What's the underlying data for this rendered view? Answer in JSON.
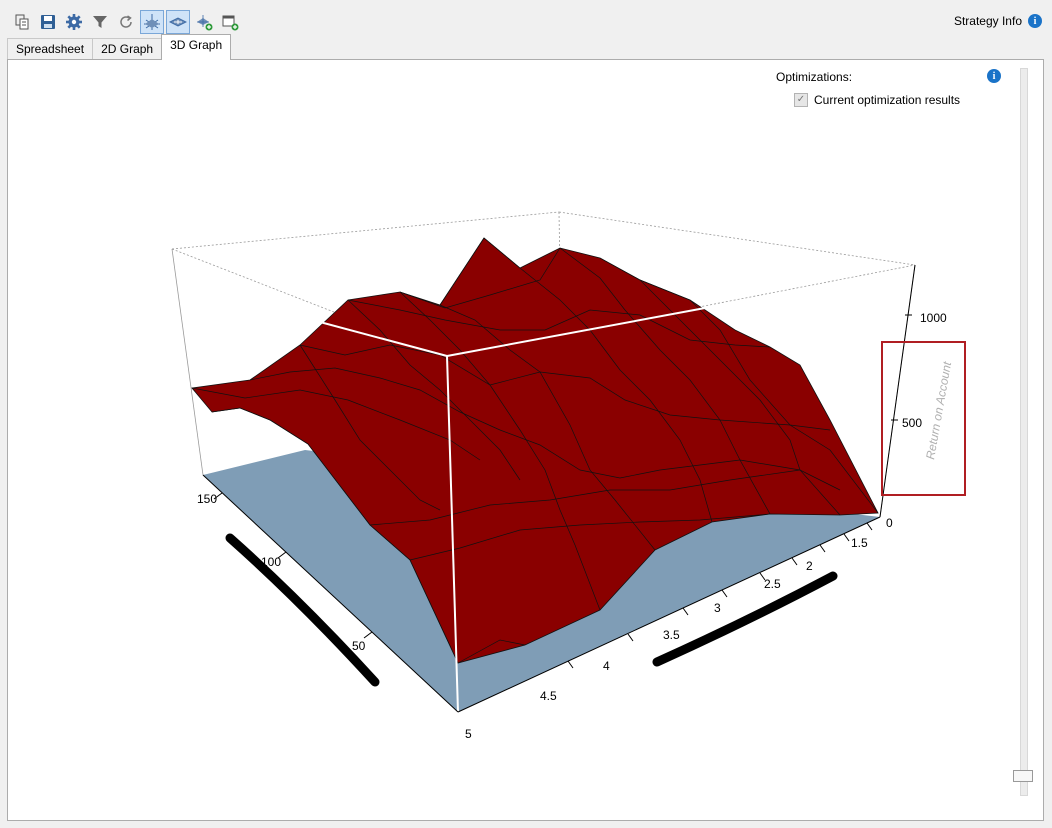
{
  "toolbar": {
    "buttons": [
      {
        "icon": "copy-icon",
        "active": false
      },
      {
        "icon": "save-icon",
        "active": false
      },
      {
        "icon": "gear-icon",
        "active": false
      },
      {
        "icon": "filter-icon",
        "active": false
      },
      {
        "icon": "reset-icon",
        "active": false
      },
      {
        "icon": "surface-mode-icon",
        "active": true
      },
      {
        "icon": "flat-mode-icon",
        "active": true
      },
      {
        "icon": "add-layer-icon",
        "active": false
      },
      {
        "icon": "new-window-icon",
        "active": false
      }
    ]
  },
  "header": {
    "strategy_info_label": "Strategy Info"
  },
  "tabs": [
    {
      "label": "Spreadsheet",
      "active": false
    },
    {
      "label": "2D Graph",
      "active": false
    },
    {
      "label": "3D Graph",
      "active": true
    }
  ],
  "optimizations": {
    "label": "Optimizations:",
    "checkbox_label": "Current optimization results",
    "checked": true
  },
  "chart_data": {
    "type": "surface3d",
    "z_axis": {
      "label": "Return on Account",
      "ticks": [
        "1000",
        "500",
        "0"
      ]
    },
    "left_axis": {
      "ticks": [
        "150",
        "100",
        "50"
      ]
    },
    "right_axis": {
      "ticks": [
        "1.5",
        "2",
        "2.5",
        "3",
        "3.5",
        "4",
        "4.5",
        "5"
      ]
    },
    "colors": {
      "low": "#8a0000",
      "mid": "#00008a",
      "high": "#1e8a1e",
      "base": "#7f9db6"
    },
    "annotation_box_color": "#b01e23"
  }
}
